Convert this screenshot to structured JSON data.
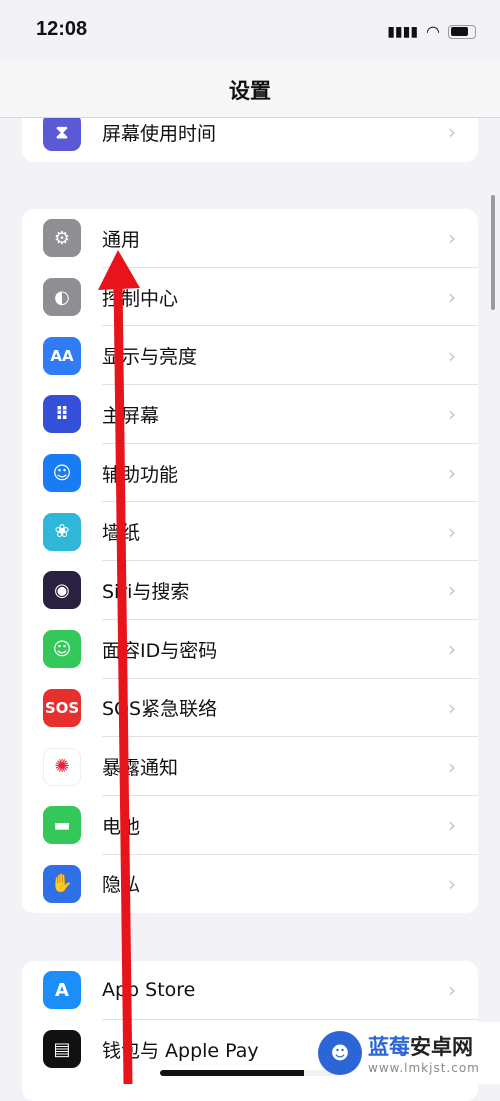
{
  "status": {
    "time": "12:08"
  },
  "nav": {
    "title": "设置"
  },
  "groups": [
    [
      {
        "label": "屏幕使用时间",
        "icon": "hourglass-icon",
        "color": "#5a5ad6",
        "glyph": "⧗"
      }
    ],
    [
      {
        "label": "通用",
        "icon": "gear-icon",
        "color": "#8e8e93",
        "glyph": "⚙"
      },
      {
        "label": "控制中心",
        "icon": "toggle-icon",
        "color": "#8e8e93",
        "glyph": "◐"
      },
      {
        "label": "显示与亮度",
        "icon": "text-size-icon",
        "color": "#2f7cf6",
        "glyph": "AA"
      },
      {
        "label": "主屏幕",
        "icon": "home-grid-icon",
        "color": "#3550d8",
        "glyph": "⠿"
      },
      {
        "label": "辅助功能",
        "icon": "accessibility-icon",
        "color": "#1a7cf5",
        "glyph": "☺"
      },
      {
        "label": "墙纸",
        "icon": "flower-icon",
        "color": "#2fb6d8",
        "glyph": "❀"
      },
      {
        "label": "Siri与搜索",
        "icon": "siri-icon",
        "color": "#2a2040",
        "glyph": "◉"
      },
      {
        "label": "面容ID与密码",
        "icon": "face-id-icon",
        "color": "#34c759",
        "glyph": "☺"
      },
      {
        "label": "SOS紧急联络",
        "icon": "sos-icon",
        "color": "#e5302d",
        "glyph": "SOS"
      },
      {
        "label": "暴露通知",
        "icon": "exposure-icon",
        "color": "#ffffff",
        "glyph": "✺"
      },
      {
        "label": "电池",
        "icon": "battery-icon",
        "color": "#34c759",
        "glyph": "▬"
      },
      {
        "label": "隐私",
        "icon": "hand-icon",
        "color": "#2f6fe8",
        "glyph": "✋"
      }
    ],
    [
      {
        "label": "App Store",
        "icon": "app-store-icon",
        "color": "#1c8ef9",
        "glyph": "A"
      },
      {
        "label": "钱包与 Apple Pay",
        "icon": "wallet-icon",
        "color": "#111111",
        "glyph": "▤"
      }
    ]
  ],
  "annotation": {
    "color": "#e8141b"
  },
  "watermark": {
    "brand_a": "蓝莓",
    "brand_b": "安卓网",
    "url": "www.lmkjst.com"
  }
}
